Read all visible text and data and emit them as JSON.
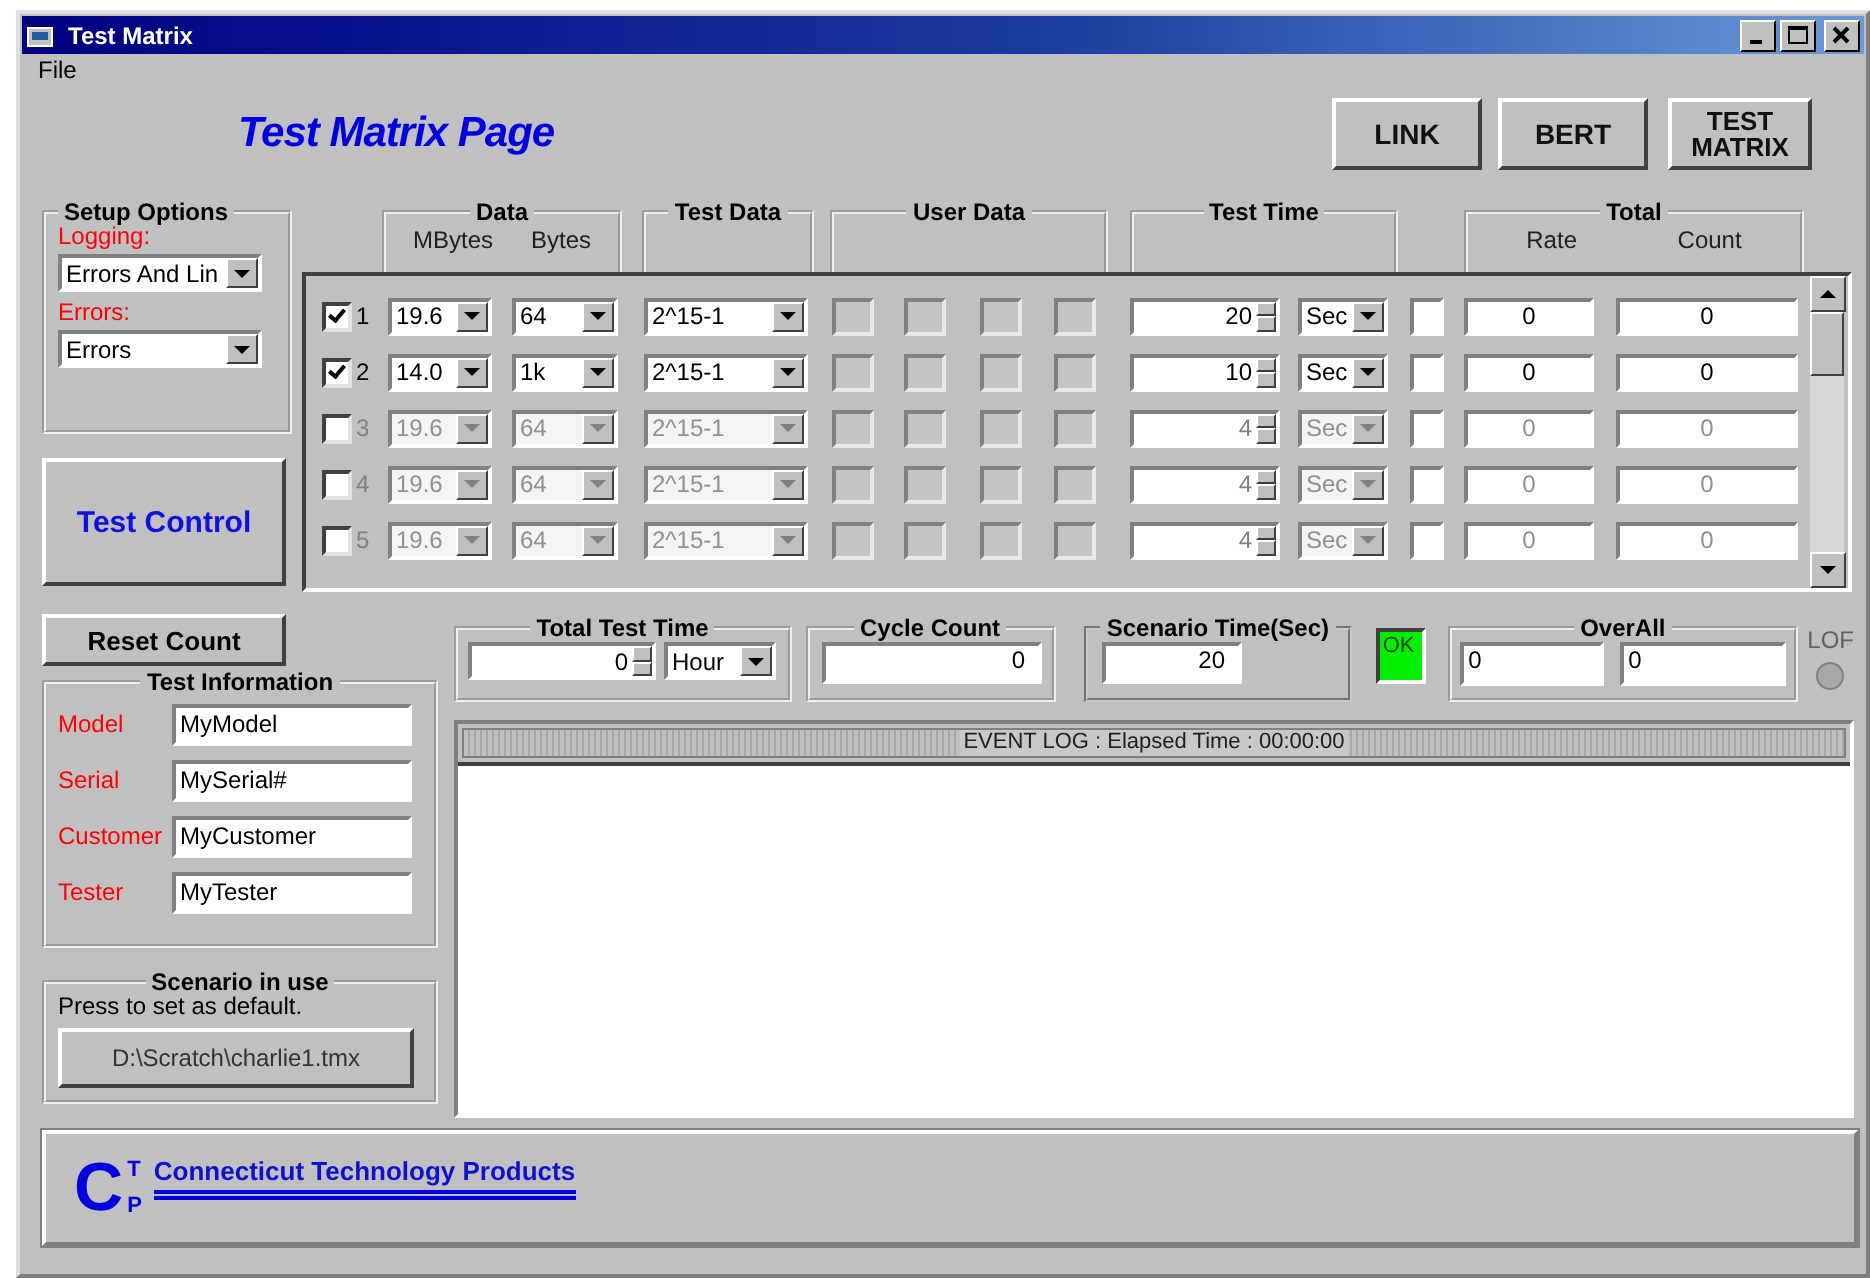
{
  "window": {
    "title": "Test Matrix"
  },
  "menu": [
    "File"
  ],
  "page_title": "Test Matrix Page",
  "nav_buttons": [
    "LINK",
    "BERT",
    "TEST MATRIX"
  ],
  "setup_options": {
    "title": "Setup Options",
    "logging_label": "Logging:",
    "logging_value": "Errors And Lin",
    "errors_label": "Errors:",
    "errors_value": "Errors"
  },
  "test_control_button": "Test Control",
  "grid": {
    "groups": [
      {
        "title": "Data",
        "columns": [
          "MBytes",
          "Bytes"
        ]
      },
      {
        "title": "Test Data"
      },
      {
        "title": "User Data"
      },
      {
        "title": "Test Time"
      },
      {
        "title": "Total",
        "columns": [
          "Rate",
          "Count"
        ]
      }
    ],
    "rows": [
      {
        "number": "1",
        "checked": true,
        "disabled": false,
        "mbytes": "19.6",
        "bytes": "64",
        "test_data": "2^15-1",
        "time": "20",
        "unit": "Sec",
        "rate": "0",
        "count": "0"
      },
      {
        "number": "2",
        "checked": true,
        "disabled": false,
        "mbytes": "14.0",
        "bytes": "1k",
        "test_data": "2^15-1",
        "time": "10",
        "unit": "Sec",
        "rate": "0",
        "count": "0"
      },
      {
        "number": "3",
        "checked": false,
        "disabled": true,
        "mbytes": "19.6",
        "bytes": "64",
        "test_data": "2^15-1",
        "time": "4",
        "unit": "Sec",
        "rate": "0",
        "count": "0"
      },
      {
        "number": "4",
        "checked": false,
        "disabled": true,
        "mbytes": "19.6",
        "bytes": "64",
        "test_data": "2^15-1",
        "time": "4",
        "unit": "Sec",
        "rate": "0",
        "count": "0"
      },
      {
        "number": "5",
        "checked": false,
        "disabled": true,
        "mbytes": "19.6",
        "bytes": "64",
        "test_data": "2^15-1",
        "time": "4",
        "unit": "Sec",
        "rate": "0",
        "count": "0"
      }
    ]
  },
  "reset_count_button": "Reset Count",
  "test_information": {
    "title": "Test Information",
    "fields": [
      {
        "label": "Model",
        "value": "MyModel"
      },
      {
        "label": "Serial",
        "value": "MySerial#"
      },
      {
        "label": "Customer",
        "value": "MyCustomer"
      },
      {
        "label": "Tester",
        "value": "MyTester"
      }
    ]
  },
  "scenario": {
    "title": "Scenario in use",
    "hint": "Press to set as default.",
    "file_button": "D:\\Scratch\\charlie1.tmx"
  },
  "total_test_time": {
    "title": "Total Test Time",
    "value": "0",
    "unit": "Hour"
  },
  "cycle_count": {
    "title": "Cycle Count",
    "value": "0"
  },
  "scenario_time": {
    "title": "Scenario Time(Sec)",
    "value": "20"
  },
  "status_light": {
    "label": "OK",
    "on": true
  },
  "overall": {
    "title": "OverAll",
    "values": [
      "0",
      "0"
    ]
  },
  "lof": {
    "label": "LOF",
    "on": false
  },
  "event_log": {
    "title": "EVENT LOG : Elapsed Time : 00:00:00"
  },
  "footer": {
    "logo_letters": [
      "C",
      "T",
      "P"
    ],
    "company": "Connecticut Technology Products"
  }
}
